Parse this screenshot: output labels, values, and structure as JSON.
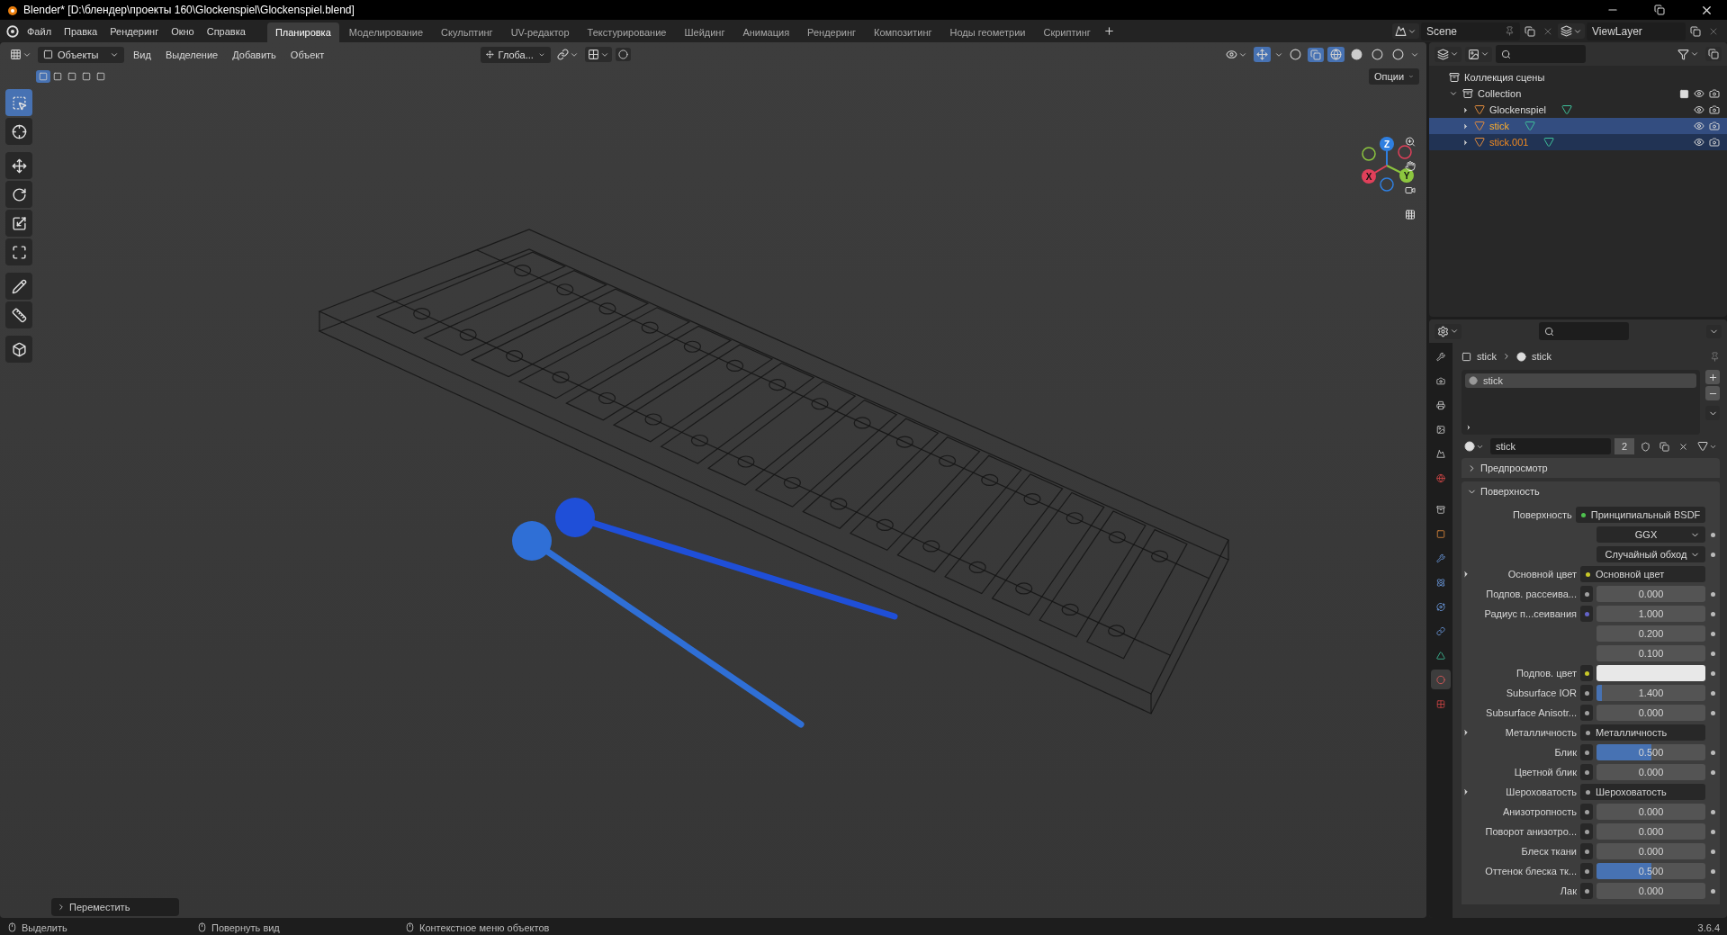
{
  "window": {
    "title": "Blender* [D:\\блендер\\проекты 160\\Glockenspiel\\Glockenspiel.blend]"
  },
  "menu": [
    "Файл",
    "Правка",
    "Рендеринг",
    "Окно",
    "Справка"
  ],
  "workspaces": [
    {
      "label": "Планировка",
      "selected": true
    },
    {
      "label": "Моделирование",
      "selected": false
    },
    {
      "label": "Скульптинг",
      "selected": false
    },
    {
      "label": "UV-редактор",
      "selected": false
    },
    {
      "label": "Текстурирование",
      "selected": false
    },
    {
      "label": "Шейдинг",
      "selected": false
    },
    {
      "label": "Анимация",
      "selected": false
    },
    {
      "label": "Рендеринг",
      "selected": false
    },
    {
      "label": "Композитинг",
      "selected": false
    },
    {
      "label": "Ноды геометрии",
      "selected": false
    },
    {
      "label": "Скриптинг",
      "selected": false
    }
  ],
  "scene": "Scene",
  "view_layer": "ViewLayer",
  "viewport": {
    "mode": "Объекты",
    "menus": [
      "Вид",
      "Выделение",
      "Добавить",
      "Объект"
    ],
    "transform_orientation": "Глоба...",
    "options": "Опции",
    "select_modes": [
      {
        "selected": true
      },
      {
        "selected": false
      },
      {
        "selected": false
      },
      {
        "selected": false
      },
      {
        "selected": false
      }
    ],
    "tools": [
      {
        "selected": true
      },
      {
        "selected": false
      },
      {
        "selected": false
      },
      {
        "selected": false
      },
      {
        "selected": false
      },
      {
        "selected": false
      },
      {
        "selected": false
      },
      {
        "selected": false
      },
      {
        "selected": false
      }
    ],
    "gizmo": [
      "X",
      "Y",
      "Z"
    ],
    "last_operator": "Переместить"
  },
  "outliner": {
    "root": "Коллекция сцены",
    "collection": {
      "name": "Collection",
      "expanded": true,
      "checked": true
    },
    "objects": [
      {
        "name": "Glockenspiel",
        "selected": false,
        "active": false
      },
      {
        "name": "stick",
        "selected": true,
        "active": true
      },
      {
        "name": "stick.001",
        "selected": true,
        "active": false
      }
    ]
  },
  "properties": {
    "tabs": [
      {
        "selected": false
      },
      {
        "selected": false
      },
      {
        "selected": false
      },
      {
        "selected": false
      },
      {
        "selected": false
      },
      {
        "selected": false
      },
      {
        "selected": false
      },
      {
        "selected": false
      },
      {
        "selected": false
      },
      {
        "selected": false
      },
      {
        "selected": false
      },
      {
        "selected": false
      },
      {
        "selected": false
      },
      {
        "selected": true
      },
      {
        "selected": false
      }
    ],
    "breadcrumb": [
      "stick",
      "stick"
    ],
    "slots": [
      {
        "name": "stick",
        "selected": true
      }
    ],
    "material": {
      "name": "stick",
      "users": "2"
    },
    "panels": [
      {
        "title": "Предпросмотр",
        "expanded": false
      },
      {
        "title": "Поверхность",
        "expanded": true,
        "rows": [
          {
            "kind": "link",
            "label": "Поверхность",
            "value": "Принципиальный BSDF",
            "color": "#4ec24e",
            "expandable": false
          },
          {
            "kind": "dropdown",
            "value": "GGX"
          },
          {
            "kind": "dropdown",
            "value": "Случайный обход"
          },
          {
            "kind": "link",
            "label": "Основной цвет",
            "value": "Основной цвет",
            "color": "#c7c729",
            "expandable": true
          },
          {
            "kind": "number",
            "label": "Подпов. рассеива...",
            "value": "0.000",
            "color": "#a1a1a1"
          },
          {
            "kind": "vector",
            "label": "Радиус п...сеивания",
            "values": [
              "1.000",
              "0.200",
              "0.100"
            ],
            "color": "#6363c7"
          },
          {
            "kind": "swatch",
            "label": "Подпов. цвет",
            "color": "#c7c729",
            "swatch": {
              "color": "#e8e8e8"
            }
          },
          {
            "kind": "number",
            "label": "Subsurface IOR",
            "value": "1.400",
            "level": 0.05,
            "color": "#a1a1a1"
          },
          {
            "kind": "number",
            "label": "Subsurface Anisotr...",
            "value": "0.000",
            "color": "#a1a1a1"
          },
          {
            "kind": "link",
            "label": "Металличность",
            "value": "Металличность",
            "color": "#a1a1a1",
            "expandable": true
          },
          {
            "kind": "number",
            "label": "Блик",
            "value": "0.500",
            "level": 0.5,
            "color": "#a1a1a1"
          },
          {
            "kind": "number",
            "label": "Цветной блик",
            "value": "0.000",
            "color": "#a1a1a1"
          },
          {
            "kind": "link",
            "label": "Шероховатость",
            "value": "Шероховатость",
            "color": "#a1a1a1",
            "expandable": true
          },
          {
            "kind": "number",
            "label": "Анизотропность",
            "value": "0.000",
            "color": "#a1a1a1"
          },
          {
            "kind": "number",
            "label": "Поворот анизотро...",
            "value": "0.000",
            "color": "#a1a1a1"
          },
          {
            "kind": "number",
            "label": "Блеск ткани",
            "value": "0.000",
            "color": "#a1a1a1"
          },
          {
            "kind": "number",
            "label": "Оттенок блеска тк...",
            "value": "0.500",
            "level": 0.5,
            "color": "#a1a1a1"
          },
          {
            "kind": "number",
            "label": "Лак",
            "value": "0.000",
            "color": "#a1a1a1"
          }
        ]
      }
    ]
  },
  "status_bar": {
    "hints": [
      "Выделить",
      "Повернуть вид",
      "Контекстное меню объектов"
    ],
    "version": "3.6.4"
  }
}
